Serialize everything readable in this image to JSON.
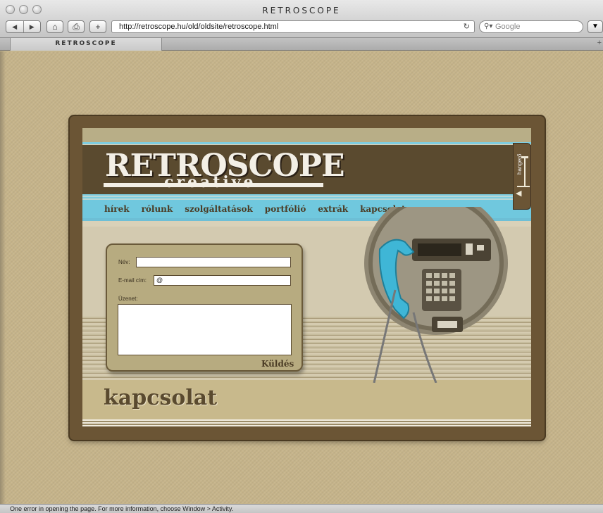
{
  "browser": {
    "window_title": "RETROSCOPE",
    "tab_title": "RETROSCOPE",
    "url": "http://retroscope.hu/old/oldsite/retroscope.html",
    "search_placeholder": "Google",
    "status": "One error in opening the page. For more information, choose Window > Activity."
  },
  "site": {
    "logo_main": "RETROSCOPE",
    "logo_sub": "creative",
    "nav": [
      "hírek",
      "rólunk",
      "szolgáltatások",
      "portfólió",
      "extrák",
      "kapcsolat"
    ],
    "page_heading": "kapcsolat",
    "volume_label": "hangerő"
  },
  "form": {
    "name_label": "Név:",
    "name_value": "",
    "email_label": "E-mail cím:",
    "email_value": "@",
    "message_label": "Üzenet:",
    "message_value": "",
    "submit_label": "Küldés"
  },
  "colors": {
    "header_brown": "#5a4a2f",
    "nav_cyan": "#70c8de",
    "page_bg": "#c6b48a",
    "phone_receiver": "#3fb6d6"
  }
}
